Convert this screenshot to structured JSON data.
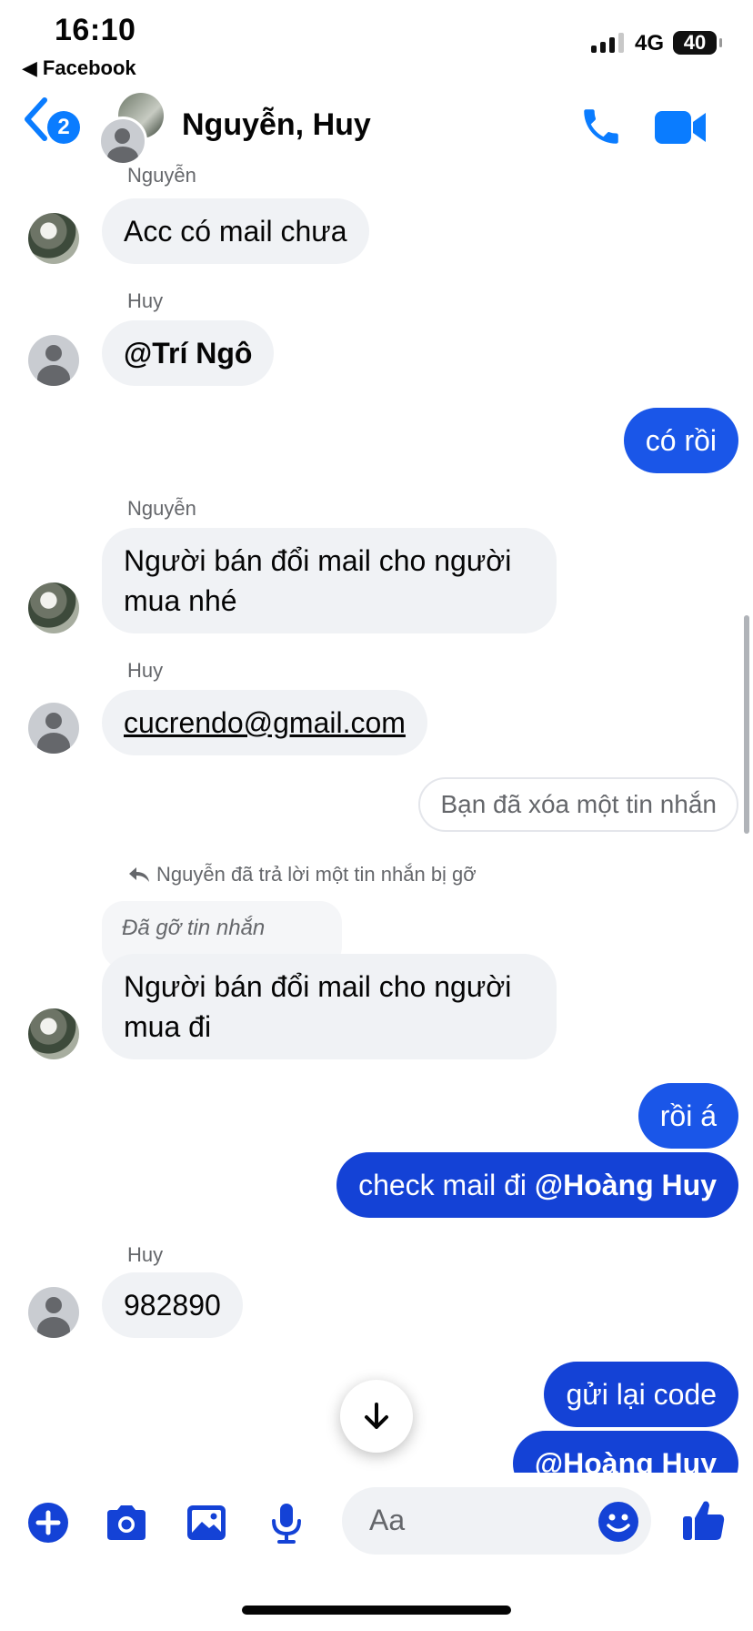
{
  "status_bar": {
    "time": "16:10",
    "back_app": "Facebook",
    "network": "4G",
    "battery": "40"
  },
  "header": {
    "unread_count": "2",
    "title": "Nguyễn, Huy"
  },
  "messages": [
    {
      "sender": "Nguyễn",
      "text": "Acc có mail chưa"
    },
    {
      "sender": "Huy",
      "text": "@Trí Ngô"
    },
    {
      "text": "có rồi"
    },
    {
      "sender": "Nguyễn",
      "text": "Người bán đổi mail cho người mua nhé"
    },
    {
      "sender": "Huy",
      "text": "cucrendo@gmail.com"
    },
    {
      "text": "Bạn đã xóa một tin nhắn"
    },
    {
      "reply_note": "Nguyễn đã trả lời một tin nhắn bị gỡ",
      "quoted": "Đã gỡ tin nhắn",
      "text": "Người bán đổi mail cho người mua đi"
    },
    {
      "text": "rồi á"
    },
    {
      "text_prefix": "check mail đi ",
      "mention": "@Hoàng Huy"
    },
    {
      "sender": "Huy",
      "text": "982890"
    },
    {
      "text": "gửi lại code"
    },
    {
      "mention": "@Hoàng Huy"
    }
  ],
  "composer": {
    "placeholder": "Aa"
  },
  "icons": [
    "back-chevron-icon",
    "phone-icon",
    "video-camera-icon",
    "plus-icon",
    "camera-icon",
    "gallery-icon",
    "microphone-icon",
    "emoji-icon",
    "thumbs-up-icon",
    "arrow-down-icon",
    "reply-arrow-icon"
  ],
  "colors": {
    "accent": "#0a7cff",
    "outgoing_bubble": "#1a56e8",
    "incoming_bubble": "#f0f2f5",
    "secondary_text": "#65676b"
  }
}
